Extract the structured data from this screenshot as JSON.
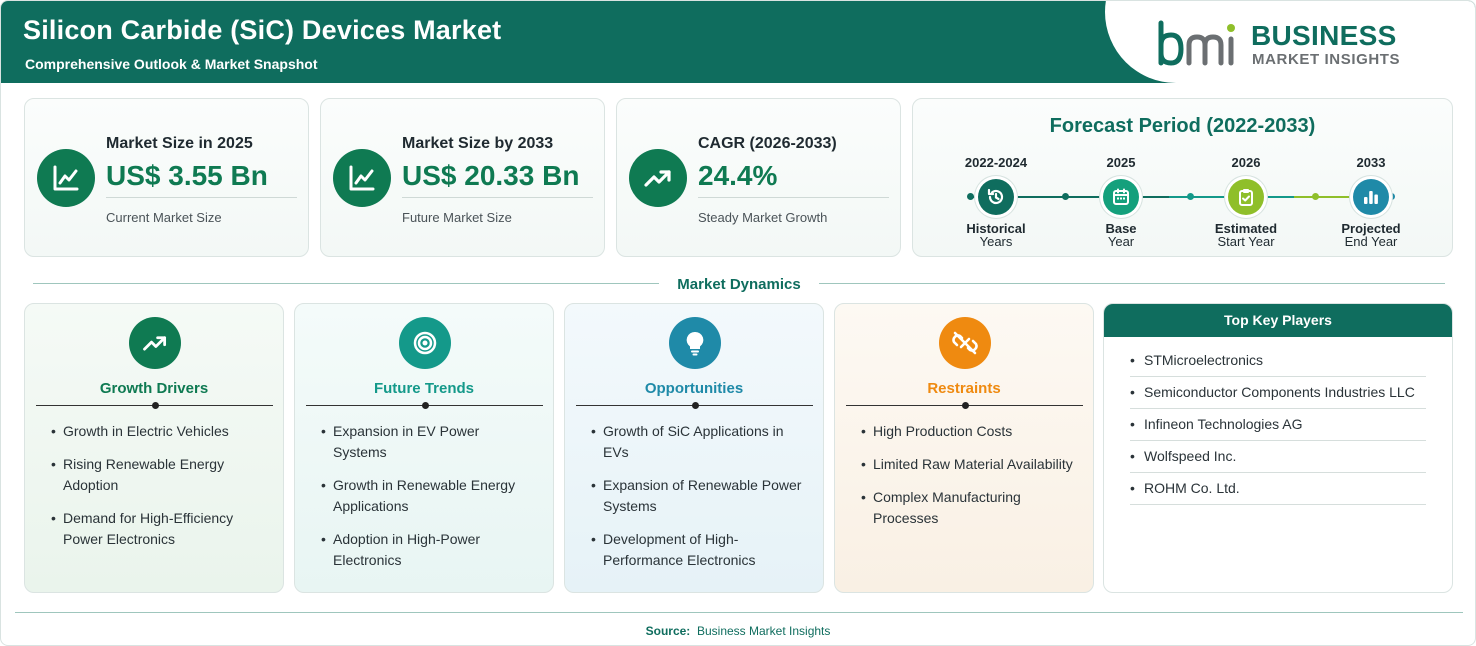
{
  "header": {
    "title": "Silicon Carbide (SiC) Devices Market",
    "subtitle": "Comprehensive Outlook & Market Snapshot",
    "logo_line1": "BUSINESS",
    "logo_line2": "MARKET INSIGHTS"
  },
  "colors": {
    "brand": "#0f6d5e",
    "accent_green": "#0f7a52",
    "teal": "#14998a",
    "blue": "#1f8aa8",
    "orange": "#ef8a10",
    "lime": "#8fbf2a"
  },
  "stats": [
    {
      "label": "Market Size in 2025",
      "value": "US$ 3.55 Bn",
      "sub": "Current Market Size",
      "icon": "line-chart-icon"
    },
    {
      "label": "Market Size by 2033",
      "value": "US$ 20.33 Bn",
      "sub": "Future Market Size",
      "icon": "line-chart-icon"
    },
    {
      "label": "CAGR (2026-2033)",
      "value": "24.4%",
      "sub": "Steady Market Growth",
      "icon": "trending-up-icon"
    }
  ],
  "forecast": {
    "title": "Forecast Period (2022-2033)",
    "steps": [
      {
        "year": "2022-2024",
        "name": "Historical",
        "sub": "Years",
        "icon": "history-icon"
      },
      {
        "year": "2025",
        "name": "Base",
        "sub": "Year",
        "icon": "calendar-icon"
      },
      {
        "year": "2026",
        "name": "Estimated",
        "sub": "Start Year",
        "icon": "clipboard-check-icon"
      },
      {
        "year": "2033",
        "name": "Projected",
        "sub": "End Year",
        "icon": "bar-chart-icon"
      }
    ]
  },
  "dynamics": {
    "title": "Market Dynamics",
    "cards": [
      {
        "title": "Growth Drivers",
        "icon": "trending-up-icon",
        "items": [
          "Growth in Electric Vehicles",
          "Rising Renewable Energy Adoption",
          "Demand for High-Efficiency Power Electronics"
        ]
      },
      {
        "title": "Future Trends",
        "icon": "target-icon",
        "items": [
          "Expansion in EV Power Systems",
          "Growth in Renewable Energy Applications",
          "Adoption in High-Power Electronics"
        ]
      },
      {
        "title": "Opportunities",
        "icon": "lightbulb-icon",
        "items": [
          "Growth of SiC Applications in EVs",
          "Expansion of Renewable Power Systems",
          "Development of High-Performance Electronics"
        ]
      },
      {
        "title": "Restraints",
        "icon": "broken-link-icon",
        "items": [
          "High Production Costs",
          "Limited Raw Material Availability",
          "Complex Manufacturing Processes"
        ]
      }
    ]
  },
  "key_players": {
    "title": "Top Key Players",
    "items": [
      "STMicroelectronics",
      "Semiconductor Components Industries LLC",
      "Infineon Technologies AG",
      "Wolfspeed Inc.",
      "ROHM Co. Ltd."
    ]
  },
  "footer": {
    "source_label": "Source:",
    "source_value": "Business Market Insights"
  }
}
